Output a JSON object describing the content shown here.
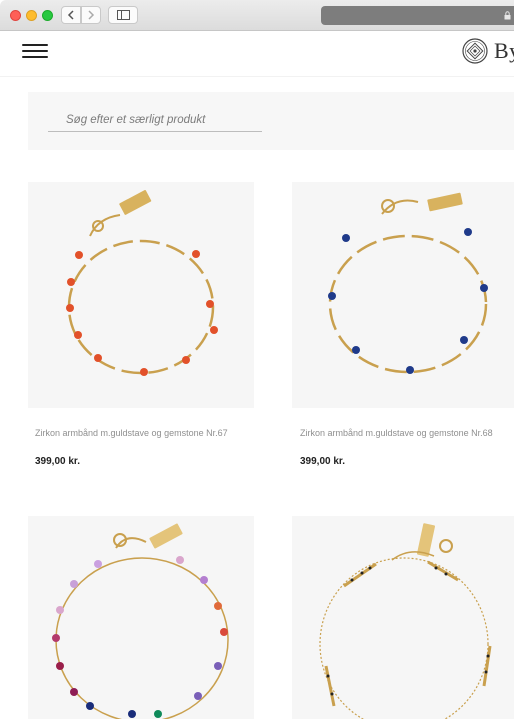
{
  "browser": {
    "back_icon": "chevron-left-icon",
    "forward_icon": "chevron-right-icon",
    "sidebar_icon": "sidebar-icon",
    "lock_icon": "lock-icon"
  },
  "header": {
    "menu_icon": "hamburger-icon",
    "logo_text": "By"
  },
  "search": {
    "placeholder": "Søg efter et særligt produkt"
  },
  "products": [
    {
      "name": "Zirkon armbånd m.guldstave og gemstone Nr.67",
      "price": "399,00 kr."
    },
    {
      "name": "Zirkon armbånd m.guldstave og gemstone Nr.68",
      "price": "399,00 kr."
    },
    {
      "name": "",
      "price": ""
    },
    {
      "name": "",
      "price": ""
    }
  ],
  "colors": {
    "page_bg": "#ffffff",
    "panel_bg": "#f7f7f7",
    "product_bg": "#f6f6f6",
    "gold": "#c9a04e",
    "bead_orange": "#e2512a",
    "bead_blue": "#1f3a8a"
  }
}
